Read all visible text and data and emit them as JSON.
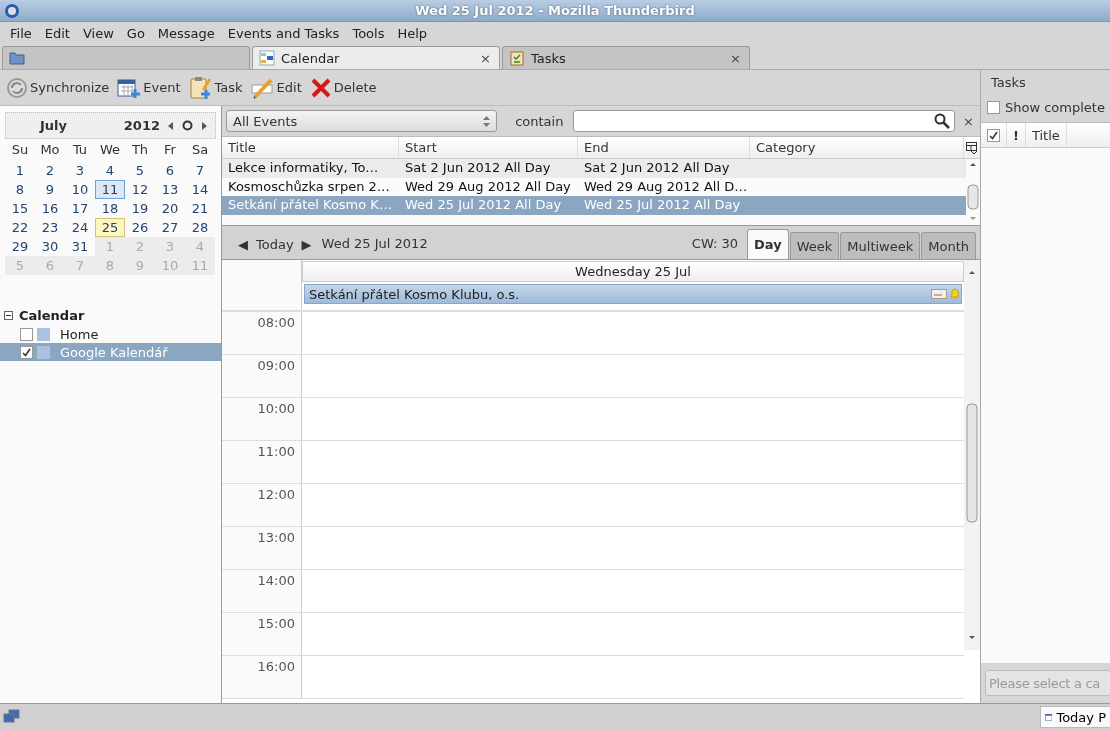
{
  "window": {
    "title": "Wed 25 Jul 2012 - Mozilla Thunderbird"
  },
  "menu": [
    "File",
    "Edit",
    "View",
    "Go",
    "Message",
    "Events and Tasks",
    "Tools",
    "Help"
  ],
  "tabs": [
    {
      "kind": "folder",
      "selected": false
    },
    {
      "kind": "calendar",
      "label": "Calendar",
      "close": "×",
      "selected": true
    },
    {
      "kind": "tasks",
      "label": "Tasks",
      "close": "×",
      "selected": false
    }
  ],
  "toolbar": [
    {
      "kind": "sync",
      "label": "Synchronize"
    },
    {
      "kind": "event",
      "label": "Event"
    },
    {
      "kind": "task",
      "label": "Task"
    },
    {
      "kind": "edit",
      "label": "Edit"
    },
    {
      "kind": "delete",
      "label": "Delete"
    }
  ],
  "minimonth": {
    "month": "July",
    "year": "2012",
    "weekdays": [
      "Su",
      "Mo",
      "Tu",
      "We",
      "Th",
      "Fr",
      "Sa"
    ],
    "weeks": [
      [
        {
          "day": "1",
          "outside": false,
          "selected": false,
          "today": false
        },
        {
          "day": "2",
          "outside": false,
          "selected": false,
          "today": false
        },
        {
          "day": "3",
          "outside": false,
          "selected": false,
          "today": false
        },
        {
          "day": "4",
          "outside": false,
          "selected": false,
          "today": false
        },
        {
          "day": "5",
          "outside": false,
          "selected": false,
          "today": false
        },
        {
          "day": "6",
          "outside": false,
          "selected": false,
          "today": false
        },
        {
          "day": "7",
          "outside": false,
          "selected": false,
          "today": false
        }
      ],
      [
        {
          "day": "8",
          "outside": false,
          "selected": false,
          "today": false
        },
        {
          "day": "9",
          "outside": false,
          "selected": false,
          "today": false
        },
        {
          "day": "10",
          "outside": false,
          "selected": false,
          "today": false
        },
        {
          "day": "11",
          "outside": false,
          "selected": true,
          "today": false
        },
        {
          "day": "12",
          "outside": false,
          "selected": false,
          "today": false
        },
        {
          "day": "13",
          "outside": false,
          "selected": false,
          "today": false
        },
        {
          "day": "14",
          "outside": false,
          "selected": false,
          "today": false
        }
      ],
      [
        {
          "day": "15",
          "outside": false,
          "selected": false,
          "today": false
        },
        {
          "day": "16",
          "outside": false,
          "selected": false,
          "today": false
        },
        {
          "day": "17",
          "outside": false,
          "selected": false,
          "today": false
        },
        {
          "day": "18",
          "outside": false,
          "selected": false,
          "today": false
        },
        {
          "day": "19",
          "outside": false,
          "selected": false,
          "today": false
        },
        {
          "day": "20",
          "outside": false,
          "selected": false,
          "today": false
        },
        {
          "day": "21",
          "outside": false,
          "selected": false,
          "today": false
        }
      ],
      [
        {
          "day": "22",
          "outside": false,
          "selected": false,
          "today": false
        },
        {
          "day": "23",
          "outside": false,
          "selected": false,
          "today": false
        },
        {
          "day": "24",
          "outside": false,
          "selected": false,
          "today": false
        },
        {
          "day": "25",
          "outside": false,
          "selected": false,
          "today": true
        },
        {
          "day": "26",
          "outside": false,
          "selected": false,
          "today": false
        },
        {
          "day": "27",
          "outside": false,
          "selected": false,
          "today": false
        },
        {
          "day": "28",
          "outside": false,
          "selected": false,
          "today": false
        }
      ],
      [
        {
          "day": "29",
          "outside": false,
          "selected": false,
          "today": false
        },
        {
          "day": "30",
          "outside": false,
          "selected": false,
          "today": false
        },
        {
          "day": "31",
          "outside": false,
          "selected": false,
          "today": false
        },
        {
          "day": "1",
          "outside": true,
          "selected": false,
          "today": false
        },
        {
          "day": "2",
          "outside": true,
          "selected": false,
          "today": false
        },
        {
          "day": "3",
          "outside": true,
          "selected": false,
          "today": false
        },
        {
          "day": "4",
          "outside": true,
          "selected": false,
          "today": false
        }
      ],
      [
        {
          "day": "5",
          "outside": true,
          "selected": false,
          "today": false
        },
        {
          "day": "6",
          "outside": true,
          "selected": false,
          "today": false
        },
        {
          "day": "7",
          "outside": true,
          "selected": false,
          "today": false
        },
        {
          "day": "8",
          "outside": true,
          "selected": false,
          "today": false
        },
        {
          "day": "9",
          "outside": true,
          "selected": false,
          "today": false
        },
        {
          "day": "10",
          "outside": true,
          "selected": false,
          "today": false
        },
        {
          "day": "11",
          "outside": true,
          "selected": false,
          "today": false
        }
      ]
    ]
  },
  "calendars": {
    "title": "Calendar",
    "expanded": true,
    "items": [
      {
        "name": "Home",
        "checked": false,
        "selected": false,
        "color": "#a8c2e0"
      },
      {
        "name": "Google Kalendář",
        "checked": true,
        "selected": true,
        "color": "#a8c2e0"
      }
    ]
  },
  "filter": {
    "select": "All Events",
    "label": "contain",
    "clear": "×"
  },
  "event_list": {
    "columns": [
      "Title",
      "Start",
      "End",
      "Category"
    ],
    "rows": [
      {
        "cells": [
          "Lekce informatiky, To…",
          "Sat 2 Jun 2012 All Day",
          "Sat 2 Jun 2012 All Day",
          ""
        ],
        "selected": false
      },
      {
        "cells": [
          "Kosmoschůzka srpen 2…",
          "Wed 29 Aug 2012 All Day",
          "Wed 29 Aug 2012 All D…",
          ""
        ],
        "selected": false
      },
      {
        "cells": [
          "Setkání přátel Kosmo K…",
          "Wed 25 Jul 2012 All Day",
          "Wed 25 Jul 2012 All Day",
          ""
        ],
        "selected": true
      }
    ]
  },
  "nav": {
    "prev": "◀",
    "today": "Today",
    "next": "▶",
    "date": "Wed 25 Jul 2012",
    "week": "CW: 30",
    "views": [
      {
        "label": "Day",
        "selected": true
      },
      {
        "label": "Week",
        "selected": false
      },
      {
        "label": "Multiweek",
        "selected": false
      },
      {
        "label": "Month",
        "selected": false
      }
    ]
  },
  "day_view": {
    "header": "Wednesday 25 Jul",
    "allday_event": "Setkání přátel Kosmo Klubu, o.s.",
    "hours": [
      "08:00",
      "09:00",
      "10:00",
      "11:00",
      "12:00",
      "13:00",
      "14:00",
      "15:00",
      "16:00"
    ]
  },
  "tasks_pane": {
    "title": "Tasks",
    "show_completed": {
      "label": "Show complete",
      "checked": false
    },
    "columns": [
      {
        "kind": "done"
      },
      {
        "kind": "priority",
        "label": "!"
      },
      {
        "kind": "title",
        "label": "Title"
      }
    ],
    "placeholder": "Please select a ca"
  },
  "status_bar": {
    "today_pane": "Today P"
  }
}
